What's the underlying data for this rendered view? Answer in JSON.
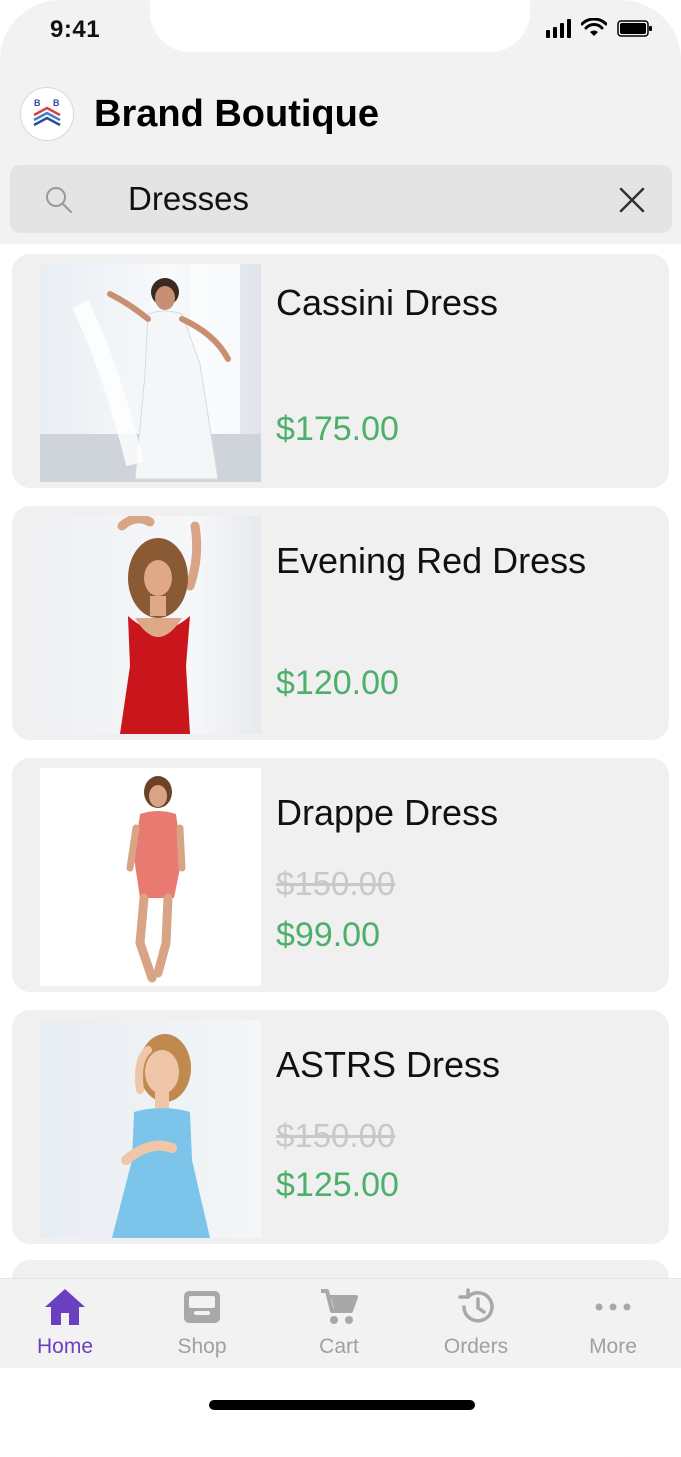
{
  "status_bar": {
    "time": "9:41"
  },
  "header": {
    "title": "Brand Boutique",
    "logo_text": "B B"
  },
  "search": {
    "value": "Dresses",
    "placeholder": "Search"
  },
  "products": [
    {
      "name": "Cassini Dress",
      "old_price": "",
      "price": "$175.00",
      "dress_color": "#f4f6f8"
    },
    {
      "name": "Evening Red Dress",
      "old_price": "",
      "price": "$120.00",
      "dress_color": "#c8161c"
    },
    {
      "name": "Drappe Dress",
      "old_price": "$150.00",
      "price": "$99.00",
      "dress_color": "#e87a72"
    },
    {
      "name": "ASTRS Dress",
      "old_price": "$150.00",
      "price": "$125.00",
      "dress_color": "#7cc4ea"
    }
  ],
  "tabs": [
    {
      "label": "Home",
      "icon": "home-icon",
      "active": true
    },
    {
      "label": "Shop",
      "icon": "inbox-icon",
      "active": false
    },
    {
      "label": "Cart",
      "icon": "cart-icon",
      "active": false
    },
    {
      "label": "Orders",
      "icon": "history-icon",
      "active": false
    },
    {
      "label": "More",
      "icon": "more-icon",
      "active": false
    }
  ],
  "colors": {
    "accent": "#6a3fc0",
    "price": "#4caf6a",
    "strike": "#c8c8c8"
  }
}
